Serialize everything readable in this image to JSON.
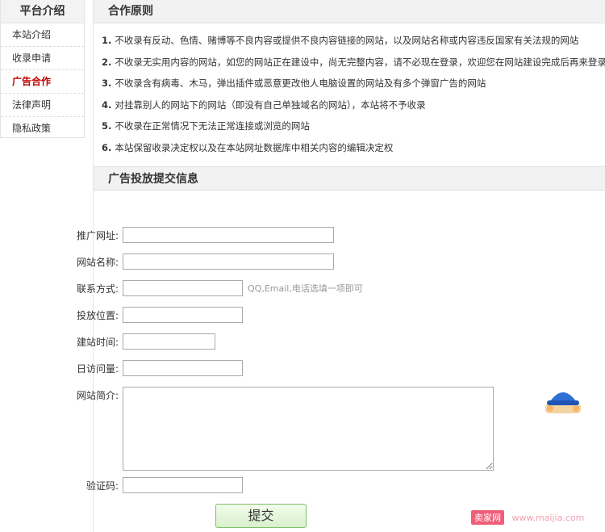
{
  "sidebar": {
    "title": "平台介绍",
    "items": [
      {
        "label": "本站介绍",
        "active": false
      },
      {
        "label": "收录申请",
        "active": false
      },
      {
        "label": "广告合作",
        "active": true
      },
      {
        "label": "法律声明",
        "active": false
      },
      {
        "label": "隐私政策",
        "active": false
      }
    ]
  },
  "principles": {
    "title": "合作原则",
    "rules": [
      {
        "num": "1.",
        "text": "不收录有反动、色情、赌博等不良内容或提供不良内容链接的网站，以及网站名称或内容违反国家有关法规的网站"
      },
      {
        "num": "2.",
        "text": "不收录无实用内容的网站，如您的网站正在建设中，尚无完整内容，请不必现在登录，欢迎您在网站建设完成后再来登录"
      },
      {
        "num": "3.",
        "text": "不收录含有病毒、木马，弹出插件或恶意更改他人电脑设置的网站及有多个弹窗广告的网站"
      },
      {
        "num": "4.",
        "text": "对挂靠别人的网站下的网站（即没有自己单独域名的网站），本站将不予收录"
      },
      {
        "num": "5.",
        "text": "不收录在正常情况下无法正常连接或浏览的网站"
      },
      {
        "num": "6.",
        "text": "本站保留收录决定权以及在本站网址数据库中相关内容的编辑决定权"
      }
    ]
  },
  "form": {
    "title": "广告投放提交信息",
    "fields": {
      "promo_url": {
        "label": "推广网址:",
        "value": ""
      },
      "site_name": {
        "label": "网站名称:",
        "value": ""
      },
      "contact": {
        "label": "联系方式:",
        "value": "",
        "hint": "QQ,Email,电话选填一项即可"
      },
      "position": {
        "label": "投放位置:",
        "value": ""
      },
      "build_time": {
        "label": "建站时间:",
        "value": ""
      },
      "daily_visits": {
        "label": "日访问量:",
        "value": ""
      },
      "intro": {
        "label": "网站简介:",
        "value": ""
      },
      "captcha": {
        "label": "验证码:",
        "value": ""
      }
    },
    "submit_label": "提交"
  },
  "watermark": {
    "logo": "卖家网",
    "url": "www.maijia.com"
  },
  "colors": {
    "active": "#c00000",
    "header_bg": "#f2f2f2",
    "submit_border": "#7fbf6d"
  }
}
